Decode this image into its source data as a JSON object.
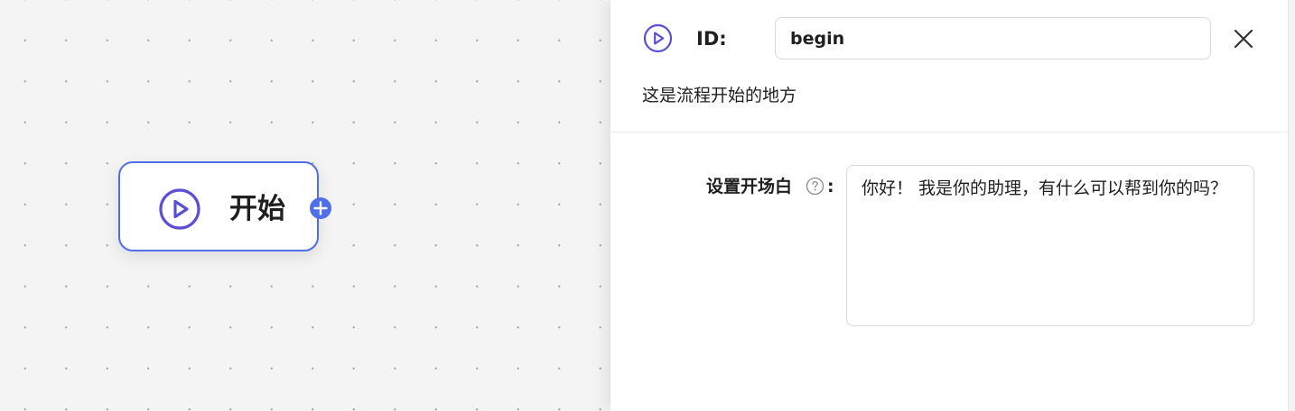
{
  "colors": {
    "accent": "#4f6fe8",
    "icon_purple": "#5b4fd6",
    "canvas_bg": "#f4f4f4",
    "panel_bg": "#ffffff",
    "text": "#1f1f1f"
  },
  "canvas": {
    "node": {
      "icon": "play-circle-icon",
      "title": "开始",
      "handle_icon": "plus-circle-icon"
    }
  },
  "panel": {
    "icon": "play-circle-icon",
    "id_label": "ID:",
    "id_value": "begin",
    "close_icon": "close-icon",
    "description": "这是流程开始的地方",
    "greeting_field": {
      "label": "设置开场白",
      "help_icon": "question-circle-icon",
      "colon": ":",
      "value": "你好！ 我是你的助理，有什么可以帮到你的吗？"
    }
  }
}
